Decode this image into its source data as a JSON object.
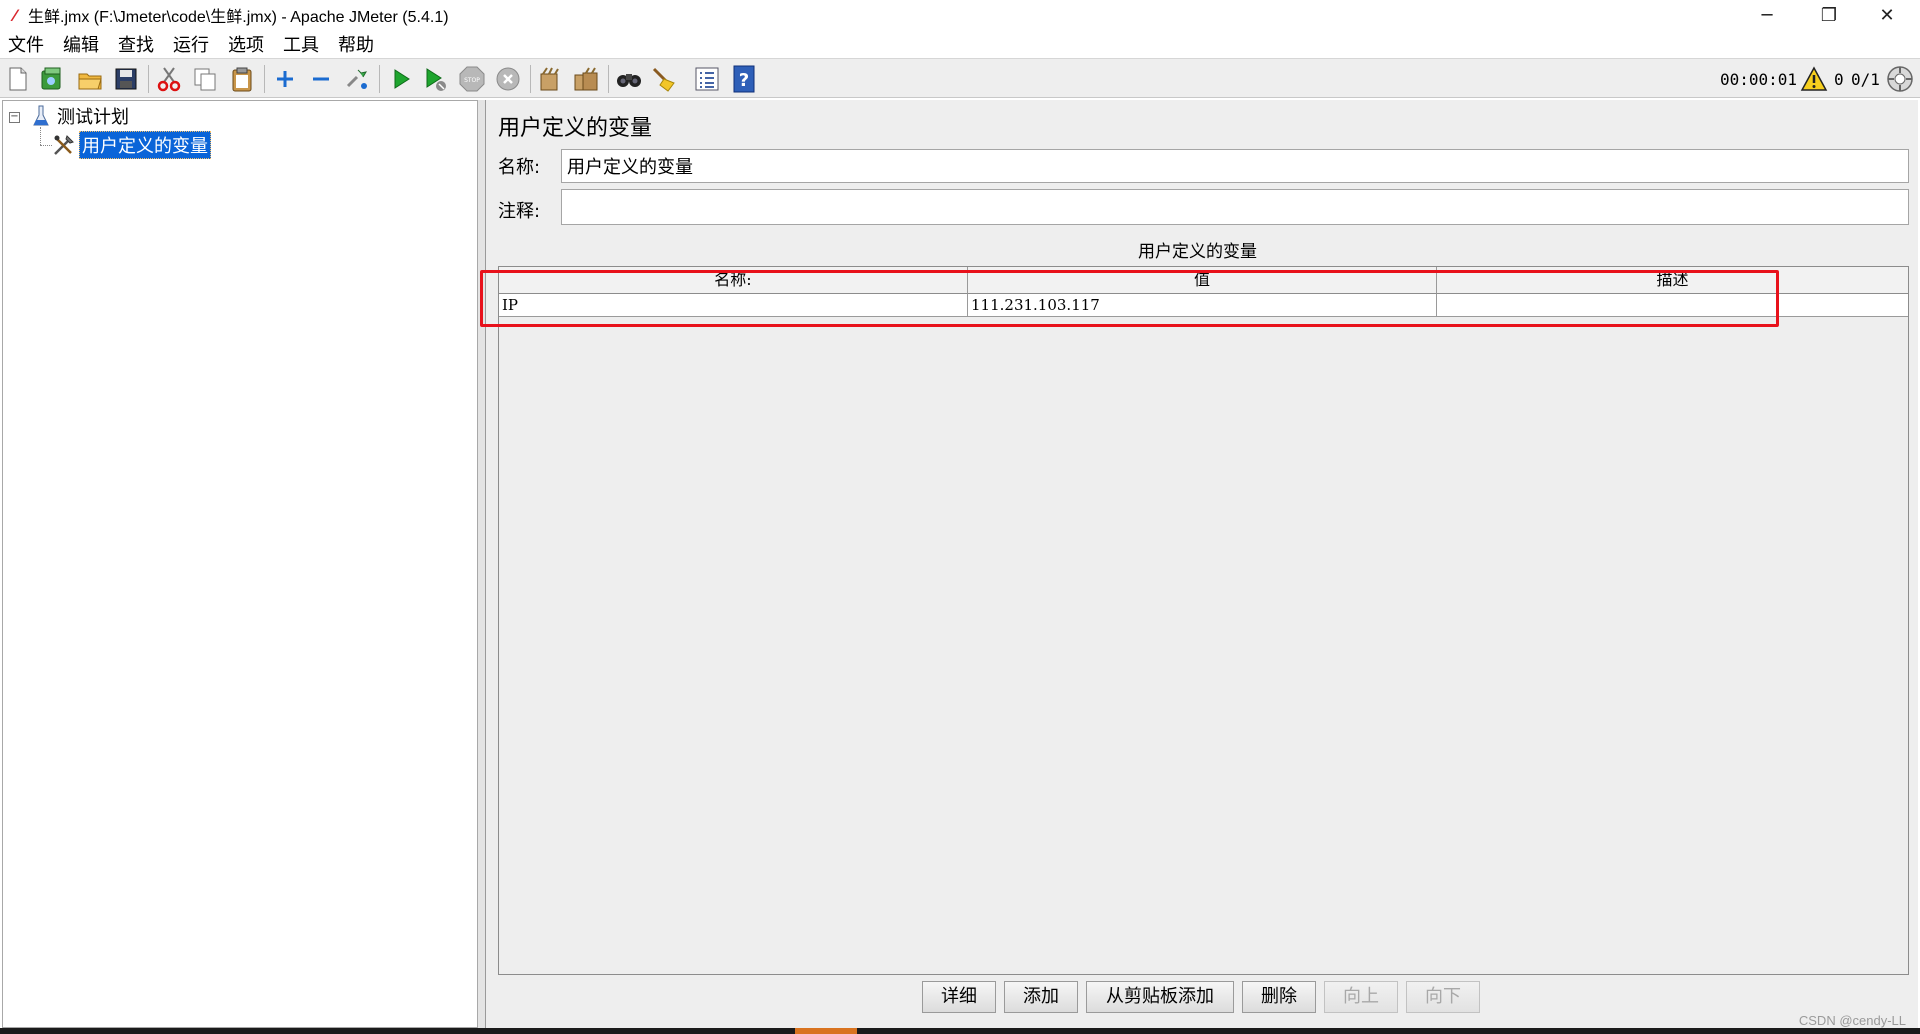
{
  "window": {
    "title": "生鲜.jmx (F:\\Jmeter\\code\\生鲜.jmx) - Apache JMeter (5.4.1)",
    "minimize": "─",
    "restore": "❐",
    "close": "✕"
  },
  "menu": {
    "items": [
      "文件",
      "编辑",
      "查找",
      "运行",
      "选项",
      "工具",
      "帮助"
    ]
  },
  "toolbar": {
    "icons": [
      "new-icon",
      "templates-icon",
      "open-icon",
      "save-icon",
      "cut-icon",
      "copy-icon",
      "paste-icon",
      "expand-icon",
      "collapse-icon",
      "toggle-icon",
      "start-icon",
      "start-no-pause-icon",
      "stop-icon",
      "shutdown-icon",
      "clear-icon",
      "clear-all-icon",
      "search-icon",
      "reset-search-icon",
      "function-helper-icon",
      "help-icon"
    ],
    "timer": "00:00:01",
    "warning_count": "0",
    "threads": "0/1"
  },
  "tree": {
    "root_label": "测试计划",
    "child_label": "用户定义的变量"
  },
  "panel": {
    "title": "用户定义的变量",
    "name_label": "名称:",
    "name_value": "用户定义的变量",
    "comment_label": "注释:",
    "comment_value": "",
    "table_caption": "用户定义的变量",
    "columns": [
      "名称:",
      "值",
      "描述"
    ],
    "rows": [
      {
        "name": "IP",
        "value": "111.231.103.117",
        "description": ""
      }
    ]
  },
  "buttons": {
    "detail": "详细",
    "add": "添加",
    "add_from_clipboard": "从剪贴板添加",
    "delete": "删除",
    "up": "向上",
    "down": "向下"
  },
  "colors": {
    "highlight": "#e8111b",
    "selection": "#0a64d8"
  },
  "watermark": "CSDN @cendy-LL"
}
